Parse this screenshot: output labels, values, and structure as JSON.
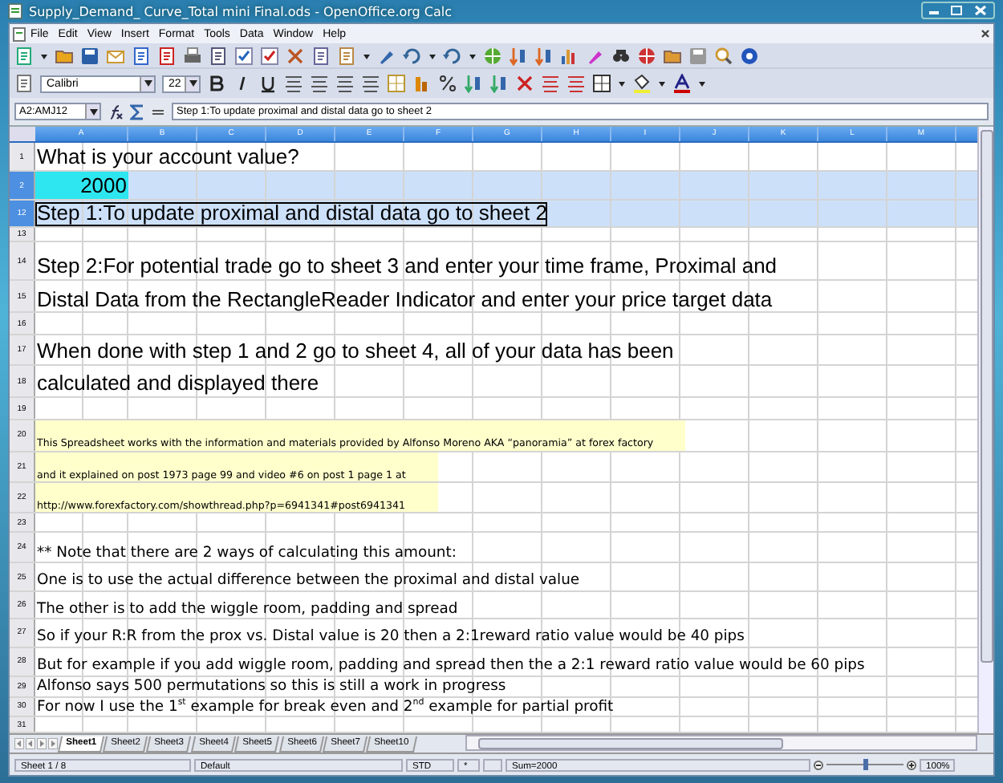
{
  "window": {
    "title": "Supply_Demand_ Curve_Total mini Final.ods - OpenOffice.org Calc"
  },
  "menu": [
    "File",
    "Edit",
    "View",
    "Insert",
    "Format",
    "Tools",
    "Data",
    "Window",
    "Help"
  ],
  "format_bar": {
    "font": "Calibri",
    "size": "22"
  },
  "formula_bar": {
    "name_box": "A2:AMJ12",
    "formula": "Step 1:To update proximal and distal data go to sheet 2"
  },
  "columns": [
    "A",
    "B",
    "C",
    "D",
    "E",
    "F",
    "G",
    "H",
    "I",
    "J",
    "K",
    "L",
    "M"
  ],
  "rows": [
    {
      "number": "1",
      "kind": "large",
      "text": "What is your account value?",
      "selected": false,
      "active": false
    },
    {
      "number": "2",
      "kind": "value",
      "text": "2000",
      "selected": true,
      "active": false
    },
    {
      "number": "12",
      "kind": "large",
      "text": "Step 1:To update proximal and distal data go to sheet 2",
      "selected": true,
      "active": true
    },
    {
      "number": "13",
      "kind": "blank",
      "selected": false,
      "active": false
    },
    {
      "number": "14",
      "kind": "large",
      "text": "Step 2:For potential trade go to sheet 3 and enter your time frame, Proximal and",
      "selected": false,
      "active": false
    },
    {
      "number": "15",
      "kind": "large",
      "text": "Distal Data from the RectangleReader Indicator and enter your price target data",
      "selected": false,
      "active": false
    },
    {
      "number": "16",
      "kind": "blank",
      "selected": false,
      "active": false
    },
    {
      "number": "17",
      "kind": "large",
      "text": "When done with step 1 and 2 go to sheet 4, all of your data has been",
      "selected": false,
      "active": false
    },
    {
      "number": "18",
      "kind": "large",
      "text": "calculated and displayed there",
      "selected": false,
      "active": false
    },
    {
      "number": "19",
      "kind": "blank",
      "selected": false,
      "active": false
    },
    {
      "number": "20",
      "kind": "note",
      "text": "This Spreadsheet works with the information and materials provided by Alfonso Moreno AKA “panoramia” at forex factory",
      "selected": false,
      "active": false
    },
    {
      "number": "21",
      "kind": "note",
      "text": "and it explained on post 1973 page 99 and video #6 on post 1 page 1 at",
      "selected": false,
      "active": false
    },
    {
      "number": "22",
      "kind": "note",
      "text": "http://www.forexfactory.com/showthread.php?p=6941341#post6941341",
      "selected": false,
      "active": false
    },
    {
      "number": "23",
      "kind": "blank",
      "selected": false,
      "active": false
    },
    {
      "number": "24",
      "kind": "body",
      "text": "** Note that there are 2 ways of calculating this amount:",
      "selected": false,
      "active": false
    },
    {
      "number": "25",
      "kind": "body",
      "text": "One is to use the actual difference between the proximal and distal value",
      "selected": false,
      "active": false
    },
    {
      "number": "26",
      "kind": "body",
      "text": "The other is to add the wiggle room, padding and spread",
      "selected": false,
      "active": false
    },
    {
      "number": "27",
      "kind": "body",
      "text": "So if your R:R from the prox vs. Distal value is 20 then a 2:1reward ratio value would be 40 pips",
      "selected": false,
      "active": false
    },
    {
      "number": "28",
      "kind": "body",
      "text": "But for example if you add wiggle room, padding and spread then the a 2:1 reward ratio value would be 60 pips",
      "selected": false,
      "active": false
    },
    {
      "number": "29",
      "kind": "body",
      "text": "Alfonso says 500 permutations so this is still a work in progress",
      "selected": false,
      "active": false
    },
    {
      "number": "30",
      "kind": "body",
      "text": "For now I use the 1$^{st}$ example for break even and 2$^{nd}$ example for partial profit",
      "selected": false,
      "active": false
    },
    {
      "number": "31",
      "kind": "blank",
      "selected": false,
      "active": false
    }
  ],
  "sheet_tabs": [
    {
      "label": "Sheet1",
      "selected": true
    },
    {
      "label": "Sheet2",
      "selected": false
    },
    {
      "label": "Sheet3",
      "selected": false
    },
    {
      "label": "Sheet4",
      "selected": false
    },
    {
      "label": "Sheet5",
      "selected": false
    },
    {
      "label": "Sheet6",
      "selected": false
    },
    {
      "label": "Sheet7",
      "selected": false
    },
    {
      "label": "Sheet10",
      "selected": false
    }
  ],
  "status_bar": {
    "sheet": "Sheet 1 / 8",
    "style": "Default",
    "mode": "STD",
    "modified": "*",
    "sum": "Sum=2000",
    "zoom": {
      "level": 0.5,
      "reading": "100%"
    }
  }
}
